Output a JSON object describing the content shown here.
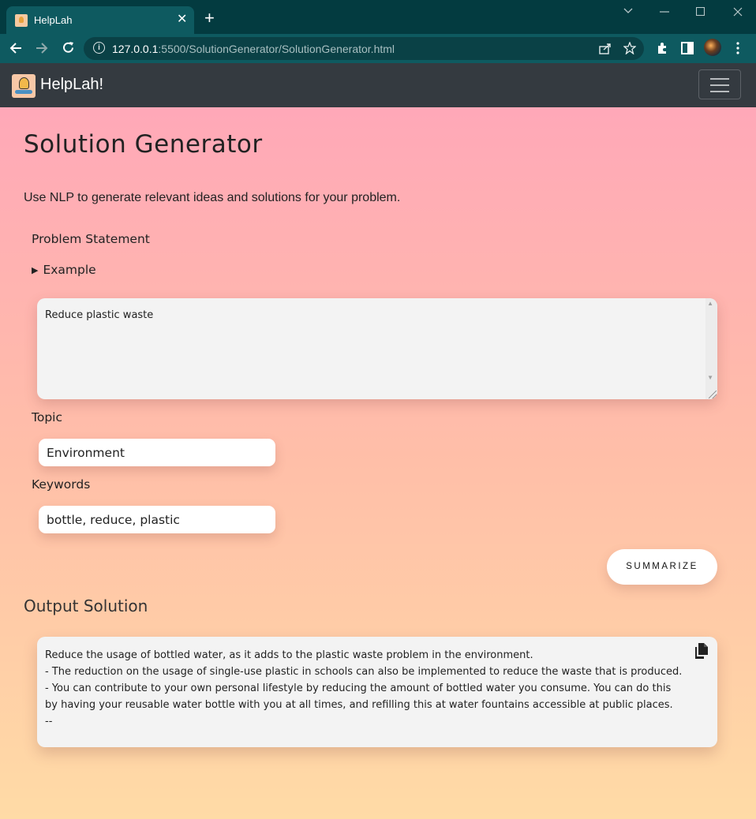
{
  "browser": {
    "tab_title": "HelpLah",
    "tab_close": "✕",
    "new_tab": "+",
    "url_host": "127.0.0.1",
    "url_rest": ":5500/SolutionGenerator/SolutionGenerator.html"
  },
  "navbar": {
    "brand": "HelpLah!"
  },
  "page": {
    "title": "Solution Generator",
    "description": "Use NLP to generate relevant ideas and solutions for your problem.",
    "problem_label": "Problem Statement",
    "example_label": "Example",
    "problem_value": "Reduce plastic waste",
    "topic_label": "Topic",
    "topic_value": "Environment",
    "keywords_label": "Keywords",
    "keywords_value": "bottle, reduce, plastic",
    "summarize_label": "SUMMARIZE",
    "output_title": "Output Solution",
    "output_lines": [
      "Reduce the usage of bottled water, as it adds to the plastic waste problem in the environment.",
      "- The reduction on the usage of single-use plastic in schools can also be implemented to reduce the waste that is produced.",
      "- You can contribute to your own personal lifestyle by reducing the amount of bottled water you consume. You can do this by having your reusable water bottle with you at all times, and refilling this at water fountains accessible at public places.",
      "--"
    ]
  },
  "icons": {
    "copy": "copy-icon",
    "menu": "hamburger-icon"
  },
  "colors": {
    "chrome_dark": "#033b40",
    "chrome_tab": "#0e5a60",
    "navbar": "#343a40",
    "gradient_top": "#ffa8b8",
    "gradient_bottom": "#ffdba6"
  }
}
